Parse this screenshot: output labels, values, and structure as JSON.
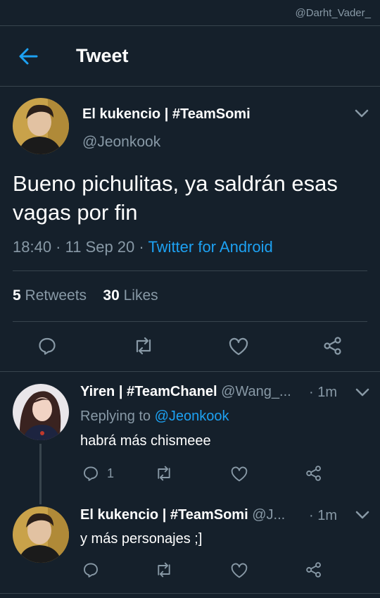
{
  "watermark": "@Darht_Vader_",
  "header": {
    "title": "Tweet"
  },
  "main_tweet": {
    "author_name": "El kukencio | #TeamSomi",
    "handle": "@Jeonkook",
    "text": "Bueno pichulitas, ya saldrán esas vagas por fin",
    "time": "18:40 · 11 Sep 20 · ",
    "source": "Twitter for Android",
    "retweets_count": "5",
    "retweets_label": " Retweets",
    "likes_count": "30",
    "likes_label": " Likes"
  },
  "replies": [
    {
      "author_name": "Yiren | #TeamChanel",
      "handle": " @Wang_...",
      "time": "· 1m",
      "replying_prefix": "Replying to ",
      "replying_handle": "@Jeonkook",
      "text": "habrá más chismeee",
      "reply_count": "1"
    },
    {
      "author_name": "El kukencio | #TeamSomi",
      "handle": " @J...",
      "time": "· 1m",
      "text": "y más personajes ;]"
    }
  ],
  "colors": {
    "background": "#15202b",
    "accent": "#1da1f2",
    "muted": "#8899a6",
    "divider": "#38444d"
  },
  "icons": [
    "back-arrow-icon",
    "chevron-down-icon",
    "reply-icon",
    "retweet-icon",
    "like-icon",
    "share-icon"
  ]
}
